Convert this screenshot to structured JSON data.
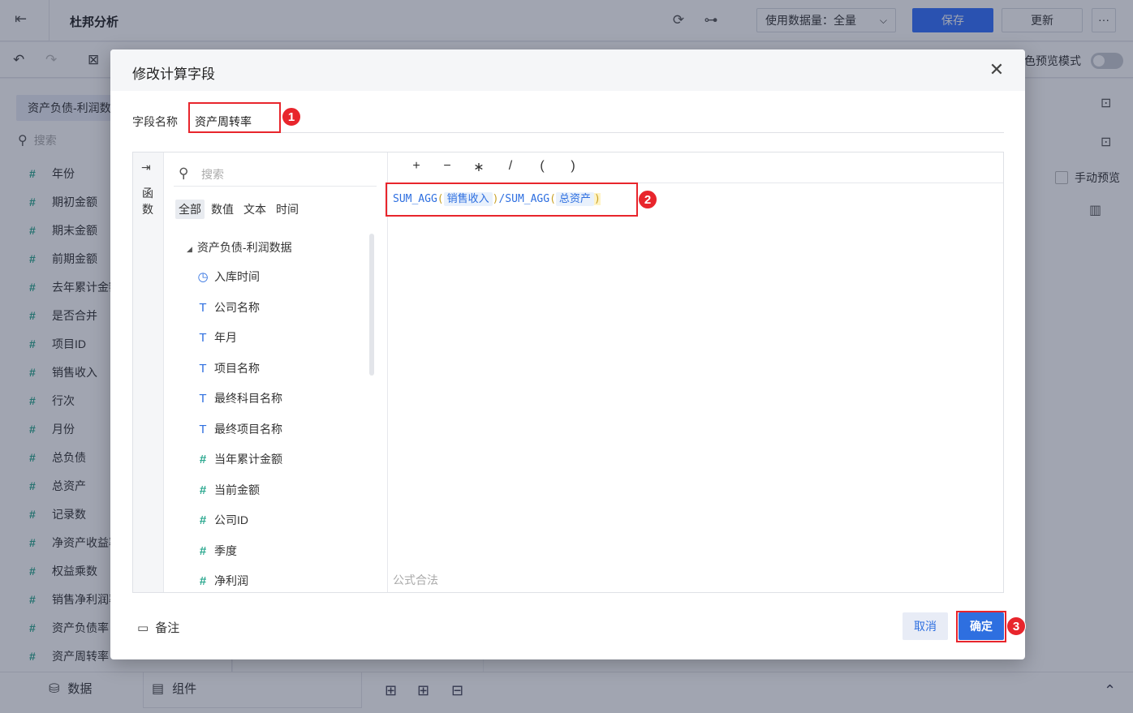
{
  "app": {
    "title": "杜邦分析",
    "data_volume": "使用数据量：全量",
    "save_label": "保存",
    "update_label": "更新",
    "more_label": "···",
    "preview_label": "色预览模式",
    "manual_preview_label": "手动预览"
  },
  "left_panel": {
    "dataset": "资产负债-利润数据",
    "search_placeholder": "搜索",
    "fields": [
      "年份",
      "期初金额",
      "期末金额",
      "前期金额",
      "去年累计金额",
      "是否合并",
      "项目ID",
      "销售收入",
      "行次",
      "月份",
      "总负债",
      "总资产",
      "记录数",
      "净资产收益率",
      "权益乘数",
      "销售净利润率",
      "资产负债率",
      "资产周转率"
    ]
  },
  "bottom": {
    "data_tab": "数据",
    "component_tab": "组件"
  },
  "dialog": {
    "title": "修改计算字段",
    "name_label": "字段名称",
    "name_value": "资产周转率",
    "rail_label": "函数",
    "search_placeholder": "搜索",
    "tabs": [
      "全部",
      "数值",
      "文本",
      "时间"
    ],
    "dataset_node": "资产负债-利润数据",
    "fields": [
      {
        "type": "time",
        "name": "入库时间"
      },
      {
        "type": "text",
        "name": "公司名称"
      },
      {
        "type": "text",
        "name": "年月"
      },
      {
        "type": "text",
        "name": "项目名称"
      },
      {
        "type": "text",
        "name": "最终科目名称"
      },
      {
        "type": "text",
        "name": "最终项目名称"
      },
      {
        "type": "num",
        "name": "当年累计金额"
      },
      {
        "type": "num",
        "name": "当前金额"
      },
      {
        "type": "num",
        "name": "公司ID"
      },
      {
        "type": "num",
        "name": "季度"
      },
      {
        "type": "num",
        "name": "净利润"
      }
    ],
    "operators": [
      "+",
      "−",
      "∗",
      "/",
      "(",
      ")"
    ],
    "formula": {
      "func1": "SUM_AGG",
      "field1": "销售收入",
      "divider": "/",
      "func2": "SUM_AGG",
      "field2": "总资产",
      "open": "(",
      "close": ")"
    },
    "validity": "公式合法",
    "memo_label": "备注",
    "cancel_label": "取消",
    "ok_label": "确定",
    "markers": [
      "1",
      "2",
      "3"
    ]
  },
  "colors": {
    "primary": "#2e6fe0",
    "highlight": "#e8252c",
    "number_icon": "#2ba88f"
  }
}
